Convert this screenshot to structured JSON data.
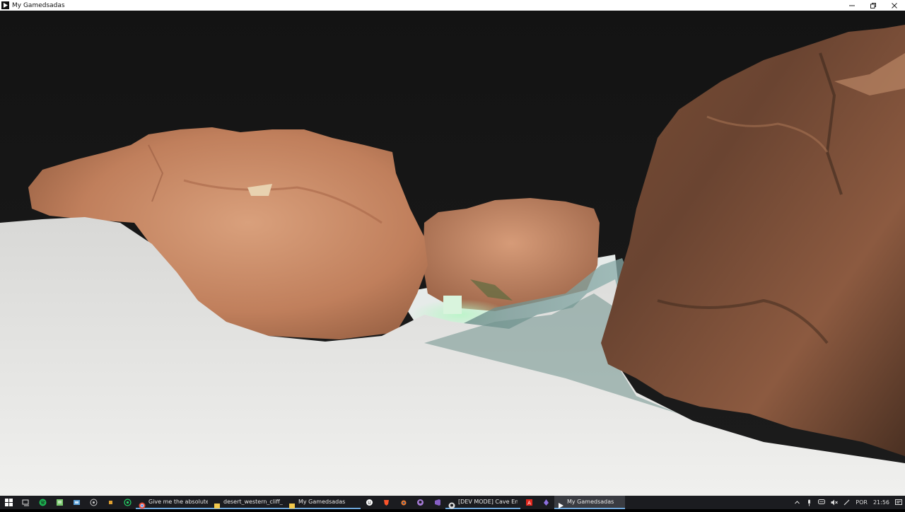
{
  "window": {
    "title": "My Gamedsadas",
    "controls": {
      "minimize": "minimize",
      "maximize": "restore",
      "close": "close"
    }
  },
  "taskbar": {
    "pinned_icons": [
      "start-icon",
      "task-view-icon",
      "spotify-icon",
      "notepad-icon",
      "control-panel-icon",
      "obs-icon",
      "app-icon",
      "whatsapp-icon"
    ],
    "apps": [
      {
        "label": "Give me the absolute ...",
        "icon": "chrome-icon",
        "color": "#e8a33d"
      },
      {
        "label": "desert_western_cliff_l...",
        "icon": "folder-icon",
        "color": "#f2c84b"
      },
      {
        "label": "My Gamedsadas",
        "icon": "folder-icon",
        "color": "#f2c84b"
      }
    ],
    "pinned_icons_2": [
      "unreal-icon",
      "brave-icon",
      "blender-icon",
      "github-icon",
      "visual-studio-icon"
    ],
    "apps_2": [
      {
        "label": "[DEV MODE] Cave En...",
        "icon": "github-desktop-icon",
        "color": "#cccccc"
      }
    ],
    "pinned_icons_3": [
      "acrobat-icon",
      "app-purple-icon"
    ],
    "active_app": {
      "label": "My Gamedsadas",
      "icon": "game-window-icon"
    },
    "tray": {
      "language": "POR",
      "time": "21:56"
    }
  }
}
